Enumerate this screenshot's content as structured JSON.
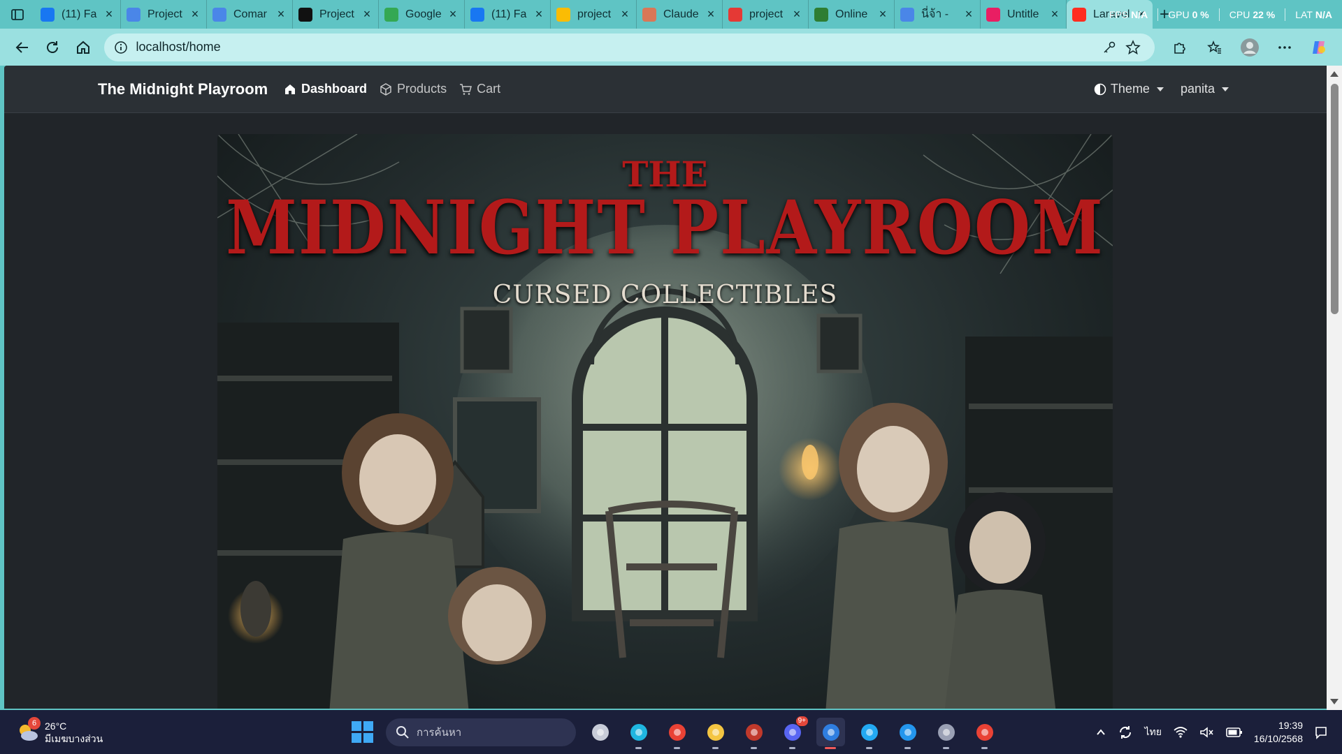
{
  "browser": {
    "tabs": [
      {
        "label": "(11) Fa",
        "icon": "facebook-icon",
        "color": "#1877f2"
      },
      {
        "label": "Project",
        "icon": "docs-icon",
        "color": "#4a86e8"
      },
      {
        "label": "Comar",
        "icon": "docs-icon",
        "color": "#4a86e8"
      },
      {
        "label": "Project",
        "icon": "github-icon",
        "color": "#111111"
      },
      {
        "label": "Google",
        "icon": "google-icon",
        "color": "#34a853"
      },
      {
        "label": "(11) Fa",
        "icon": "facebook-icon",
        "color": "#1877f2"
      },
      {
        "label": "project",
        "icon": "drive-icon",
        "color": "#fbbc04"
      },
      {
        "label": "Claude",
        "icon": "claude-icon",
        "color": "#d97757"
      },
      {
        "label": "project",
        "icon": "pdf-icon",
        "color": "#e53935"
      },
      {
        "label": "Online",
        "icon": "online-icon",
        "color": "#2e7d32"
      },
      {
        "label": "นี่จ้า -",
        "icon": "docs-icon",
        "color": "#4a86e8"
      },
      {
        "label": "Untitle",
        "icon": "miro-icon",
        "color": "#e91e63"
      },
      {
        "label": "Laravel",
        "icon": "laravel-icon",
        "color": "#ff2d20",
        "active": true
      }
    ],
    "perf": {
      "fps_label": "FPS",
      "fps_value": "N/A",
      "gpu_label": "GPU",
      "gpu_value": "0 %",
      "cpu_label": "CPU",
      "cpu_value": "22 %",
      "lat_label": "LAT",
      "lat_value": "N/A"
    },
    "url": "localhost/home"
  },
  "site": {
    "brand": "The Midnight Playroom",
    "nav": [
      {
        "label": "Dashboard",
        "icon": "home-icon",
        "active": true
      },
      {
        "label": "Products",
        "icon": "box-icon",
        "active": false
      },
      {
        "label": "Cart",
        "icon": "cart-icon",
        "active": false
      }
    ],
    "theme_label": "Theme",
    "user_label": "panita",
    "banner": {
      "the": "THE",
      "title": "MIDNIGHT PLAYROOM",
      "subtitle": "CURSED COLLECTIBLES"
    }
  },
  "taskbar": {
    "weather_temp": "26°C",
    "weather_desc": "มีเมฆบางส่วน",
    "weather_badge": "6",
    "search_placeholder": "การค้นหา",
    "apps": [
      {
        "name": "task-view-icon",
        "color": "#c8ccd8"
      },
      {
        "name": "edge-icon",
        "color": "#1fb6e0",
        "active": false
      },
      {
        "name": "chrome-icon",
        "color": "#e94235"
      },
      {
        "name": "file-explorer-icon",
        "color": "#f4c542"
      },
      {
        "name": "chrome-canary-icon",
        "color": "#c0392b"
      },
      {
        "name": "discord-icon",
        "color": "#5865f2",
        "badge": "9+"
      },
      {
        "name": "azure-data-studio-icon",
        "color": "#2f7ee0",
        "active": true
      },
      {
        "name": "vscode-icon",
        "color": "#23a9f2"
      },
      {
        "name": "docker-icon",
        "color": "#2496ed"
      },
      {
        "name": "settings-icon",
        "color": "#9aa0b4"
      },
      {
        "name": "chrome-profile-icon",
        "color": "#e94235"
      }
    ],
    "tray_lang": "ไทย",
    "time": "19:39",
    "date": "16/10/2568"
  }
}
